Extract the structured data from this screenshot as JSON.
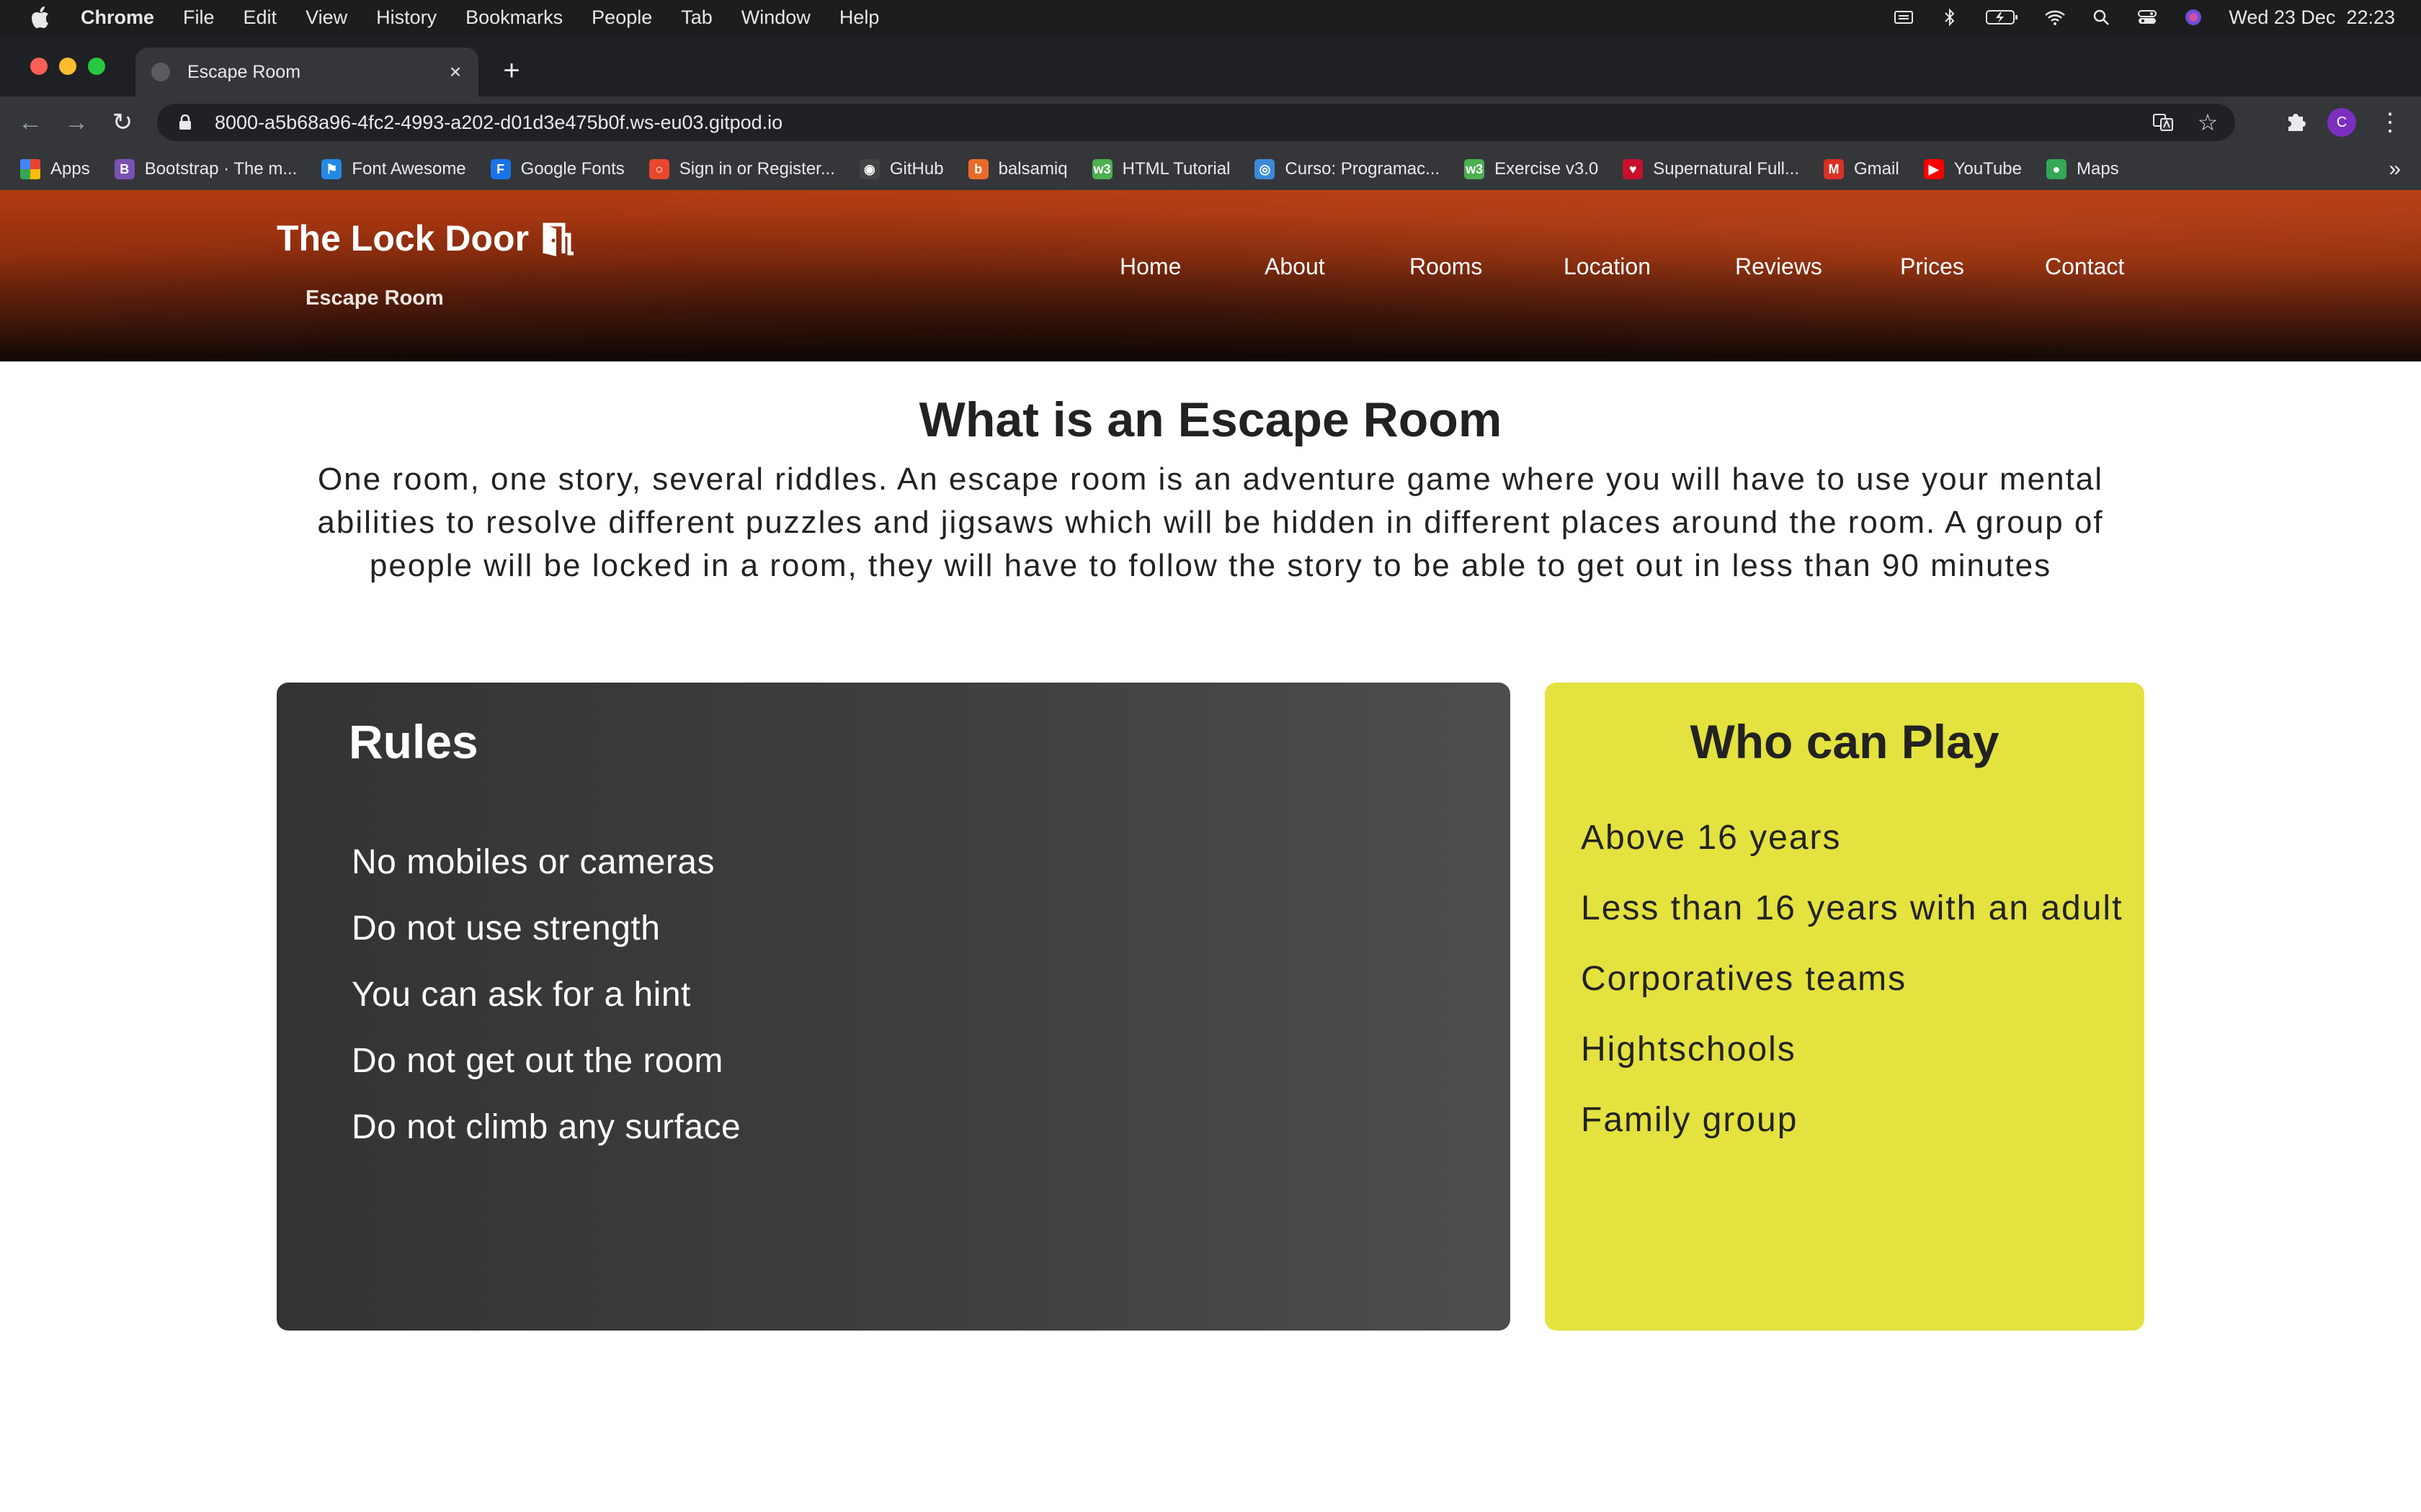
{
  "menubar": {
    "app": "Chrome",
    "items": [
      "File",
      "Edit",
      "View",
      "History",
      "Bookmarks",
      "People",
      "Tab",
      "Window",
      "Help"
    ],
    "clock": "Wed 23 Dec  22:23"
  },
  "browser": {
    "tab_title": "Escape Room",
    "url": "8000-a5b68a96-4fc2-4993-a202-d01d3e475b0f.ws-eu03.gitpod.io",
    "profile_initial": "C",
    "bookmarks": [
      {
        "label": "Apps",
        "icon": "apps-grid-icon",
        "color": "#4285f4",
        "glyph": ""
      },
      {
        "label": "Bootstrap · The m...",
        "icon": "bootstrap-icon",
        "color": "#7952b3",
        "glyph": "B"
      },
      {
        "label": "Font Awesome",
        "icon": "flag-icon",
        "color": "#228ae6",
        "glyph": "⚑"
      },
      {
        "label": "Google Fonts",
        "icon": "google-fonts-icon",
        "color": "#1a73e8",
        "glyph": "F"
      },
      {
        "label": "Sign in or Register...",
        "icon": "circle-icon",
        "color": "#e8472e",
        "glyph": "○"
      },
      {
        "label": "GitHub",
        "icon": "github-icon",
        "color": "#444444",
        "glyph": "◉"
      },
      {
        "label": "balsamiq",
        "icon": "balsamiq-icon",
        "color": "#e96b2a",
        "glyph": "b"
      },
      {
        "label": "HTML Tutorial",
        "icon": "w3schools-icon",
        "color": "#4caf50",
        "glyph": "w3"
      },
      {
        "label": "Curso: Programac...",
        "icon": "course-icon",
        "color": "#3a8bd8",
        "glyph": "◎"
      },
      {
        "label": "Exercise v3.0",
        "icon": "w3schools-icon",
        "color": "#4caf50",
        "glyph": "w3"
      },
      {
        "label": "Supernatural Full...",
        "icon": "heart-icon",
        "color": "#c8102e",
        "glyph": "♥"
      },
      {
        "label": "Gmail",
        "icon": "gmail-icon",
        "color": "#d93025",
        "glyph": "M"
      },
      {
        "label": "YouTube",
        "icon": "youtube-icon",
        "color": "#ff0000",
        "glyph": "▶"
      },
      {
        "label": "Maps",
        "icon": "maps-pin-icon",
        "color": "#34a853",
        "glyph": "●"
      }
    ]
  },
  "site": {
    "brand": "The Lock Door",
    "brand_subtitle": "Escape Room",
    "nav": [
      "Home",
      "About",
      "Rooms",
      "Location",
      "Reviews",
      "Prices",
      "Contact"
    ],
    "heading": "What is an Escape Room",
    "lead": "One room, one story, several riddles. An escape room is an adventure game where you will have to use your mental abilities to resolve different puzzles and jigsaws which will be hidden in different places around the room. A group of people will be locked in a room, they will have to follow the story to be able to get out in less than 90 minutes",
    "rules": {
      "title": "Rules",
      "items": [
        "No mobiles or cameras",
        "Do not use strength",
        "You can ask for a hint",
        "Do not get out the room",
        "Do not climb any surface"
      ]
    },
    "who": {
      "title": "Who can Play",
      "items": [
        "Above 16 years",
        "Less than 16 years with an adult",
        "Corporatives teams",
        "Hightschools",
        "Family group"
      ]
    }
  },
  "colors": {
    "who_card": "#e3e23f",
    "rules_card": "#3a3a3a",
    "hero": "#a8360f"
  }
}
